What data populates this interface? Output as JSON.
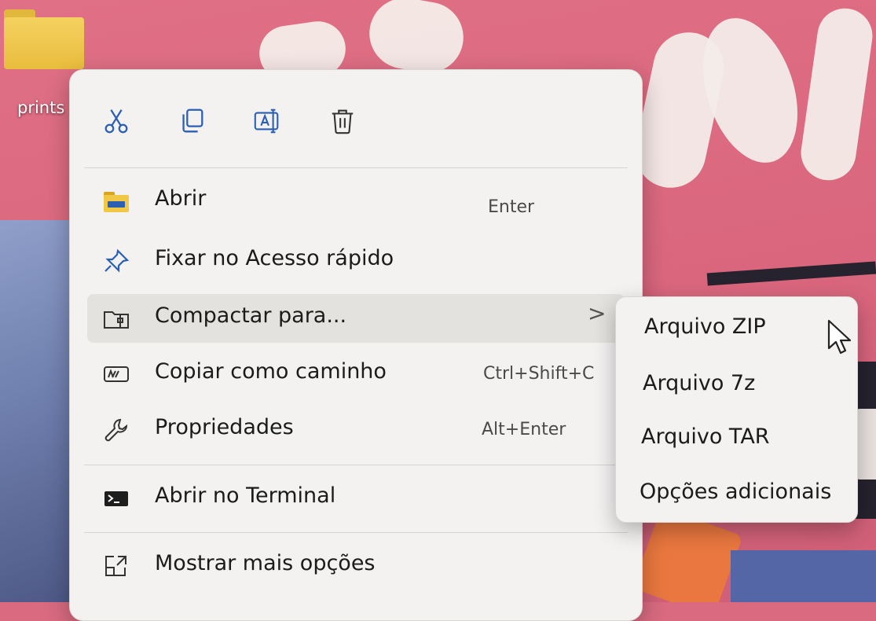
{
  "desktop": {
    "folder_label": "prints"
  },
  "context_menu": {
    "toolbar": [
      {
        "icon": "scissors-icon",
        "action": "cut"
      },
      {
        "icon": "copy-icon",
        "action": "copy"
      },
      {
        "icon": "rename-icon",
        "action": "rename"
      },
      {
        "icon": "trash-icon",
        "action": "delete"
      }
    ],
    "items": [
      {
        "label": "Abrir",
        "shortcut": "Enter",
        "icon": "folder-icon"
      },
      {
        "label": "Fixar no Acesso rápido",
        "shortcut": "",
        "icon": "pin-icon"
      },
      {
        "label": "Compactar para...",
        "shortcut": "",
        "icon": "archive-icon",
        "has_submenu": true,
        "chevron": ">"
      },
      {
        "label": "Copiar como caminho",
        "shortcut": "Ctrl+Shift+C",
        "icon": "path-icon"
      },
      {
        "label": "Propriedades",
        "shortcut": "Alt+Enter",
        "icon": "wrench-icon"
      },
      {
        "label": "Abrir no Terminal",
        "shortcut": "",
        "icon": "terminal-icon"
      },
      {
        "label": "Mostrar mais opções",
        "shortcut": "",
        "icon": "expand-icon"
      }
    ]
  },
  "submenu": {
    "items": [
      {
        "label": "Arquivo ZIP"
      },
      {
        "label": "Arquivo 7z"
      },
      {
        "label": "Arquivo TAR"
      },
      {
        "label": "Opções adicionais"
      }
    ]
  },
  "colors": {
    "menu_bg": "#f3f2f1",
    "hover_bg": "#e4e2df",
    "accent_blue": "#2a5fb3",
    "folder_yellow": "#f0c846"
  }
}
